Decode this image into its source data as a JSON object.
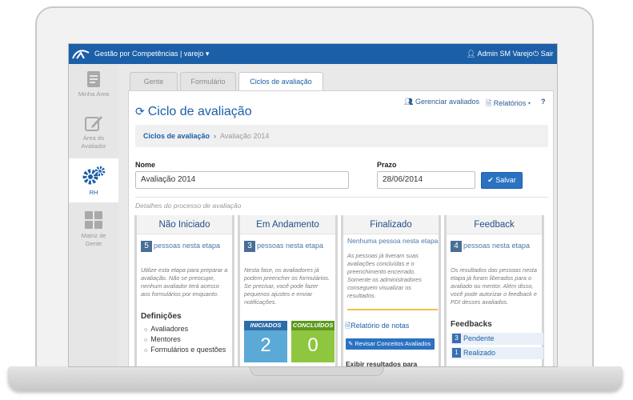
{
  "topbar": {
    "app_title": "Gestão por Competências | varejo ▾",
    "user": "Admin SM Varejo",
    "logout": "Sair"
  },
  "sidebar": {
    "items": [
      {
        "label_line1": "Minha Área",
        "label_line2": "",
        "icon": "document-icon"
      },
      {
        "label_line1": "Área do",
        "label_line2": "Avaliador",
        "icon": "edit-icon"
      },
      {
        "label_line1": "RH",
        "label_line2": "",
        "icon": "gears-icon"
      },
      {
        "label_line1": "Matriz de",
        "label_line2": "Gente",
        "icon": "grid-icon"
      }
    ]
  },
  "tabs": [
    "Gente",
    "Formulário",
    "Ciclos de avaliação"
  ],
  "toolbar": {
    "manage": "Gerenciar avaliados",
    "reports": "Relatórios ▾",
    "help": "?"
  },
  "page": {
    "title": "Ciclo de avaliação",
    "breadcrumb": [
      "Ciclos de avaliação",
      "Avaliação 2014"
    ],
    "breadcrumb_sep": "›"
  },
  "form": {
    "name_label": "Nome",
    "name_value": "Avaliação 2014",
    "deadline_label": "Prazo",
    "deadline_value": "28/06/2014",
    "save_label": "Salvar"
  },
  "section_label": "Detalhes do processo de avaliação",
  "columns": {
    "nao_iniciado": {
      "title": "Não Iniciado",
      "count": "5",
      "count_text": "pessoas nesta etapa",
      "desc": "Utilize esta etapa para preparar a avaliação. Não se preocupe, nenhum avaliador terá acesso aos formulários por enquanto.",
      "defs_title": "Definições",
      "defs": [
        "Avaliadores",
        "Mentores",
        "Formulários e questões"
      ]
    },
    "em_andamento": {
      "title": "Em Andamento",
      "count": "3",
      "count_text": "pessoas nesta etapa",
      "desc": "Nesta fase, os avaliadores já podem preencher os formulários. Se precisar, você pode fazer pequenos ajustes e enviar notificações.",
      "iniciados_label": "INICIADOS",
      "iniciados_value": "2",
      "concluidos_label": "CONCLUÍDOS",
      "concluidos_value": "0"
    },
    "finalizado": {
      "title": "Finalizado",
      "none_text": "Nenhuma pessoa nesta etapa",
      "desc": "As pessoas já tiveram suas avaliações concluídas e o preenchimento encerrado. Somente os administradores conseguem visualizar os resultados.",
      "report_link": "Relatório de notas",
      "review_button": "Revisar Conceitos Avaliados",
      "show_results": "Exibir resultados para"
    },
    "feedback": {
      "title": "Feedback",
      "count": "4",
      "count_text": "pessoas nesta etapa",
      "desc": "Os resultados das pessoas nesta etapa já foram liberados para o avaliado ou mentor. Além disso, você pode autorizar o feedback e PDI desses avaliados.",
      "fb_title": "Feedbacks",
      "items": [
        {
          "n": "3",
          "label": "Pendente"
        },
        {
          "n": "1",
          "label": "Realizado"
        }
      ]
    }
  }
}
